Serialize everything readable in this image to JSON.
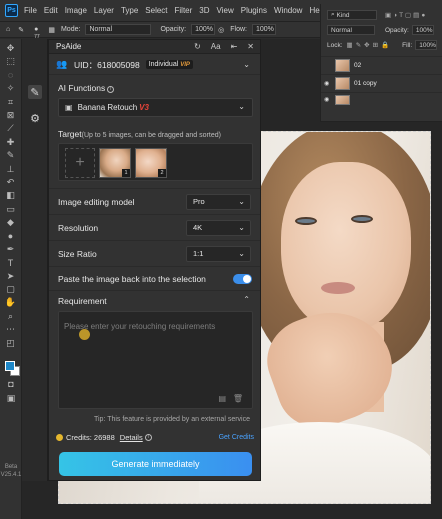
{
  "menubar": {
    "logo": "Ps",
    "items": [
      "File",
      "Edit",
      "Image",
      "Layer",
      "Type",
      "Select",
      "Filter",
      "3D",
      "View",
      "Plugins",
      "Window",
      "Help"
    ]
  },
  "options_bar": {
    "brush_size": "77",
    "mode_label": "Mode:",
    "mode_value": "Normal",
    "opacity_label": "Opacity:",
    "opacity_value": "100%",
    "flow_label": "Flow:",
    "flow_value": "100%"
  },
  "layers_panel": {
    "kind_label": "Kind",
    "blend_mode": "Normal",
    "opacity_label": "Opacity:",
    "opacity_value": "100%",
    "lock_label": "Lock:",
    "fill_label": "Fill:",
    "fill_value": "100%",
    "layers": [
      "02",
      "01 copy",
      ""
    ]
  },
  "toolbar": {
    "beta_label": "Beta",
    "version_label": "V25.4.1"
  },
  "psaide": {
    "title": "PsAide",
    "uid": "UID：618005098",
    "plan": "Individual",
    "plan_badge": "VIP",
    "ai_functions_label": "AI Functions",
    "ai_function_value": "Banana Retouch",
    "ai_function_version": "V3",
    "target_label": "Target",
    "target_hint": "(Up to 5 images, can be dragged and sorted)",
    "thumbnails": [
      "1",
      "2"
    ],
    "image_model_label": "Image editing model",
    "image_model_value": "Pro",
    "resolution_label": "Resolution",
    "resolution_value": "4K",
    "size_ratio_label": "Size Ratio",
    "size_ratio_value": "1:1",
    "paste_label": "Paste the image back into the selection",
    "paste_enabled": true,
    "requirement_label": "Requirement",
    "requirement_placeholder": "Please enter your retouching requirements",
    "tip": "Tip: This feature is provided by an external service",
    "credits_label": "Credits: 26988",
    "details_label": "Details",
    "get_credits_label": "Get Credits",
    "generate_label": "Generate immediately"
  },
  "colors": {
    "accent_blue": "#3b8eea",
    "button_gradient_start": "#35c4e6",
    "button_gradient_end": "#3a8ff0",
    "vip_orange": "#e59b3c",
    "version_red": "#e8443a",
    "coin_gold": "#e5b72e"
  }
}
